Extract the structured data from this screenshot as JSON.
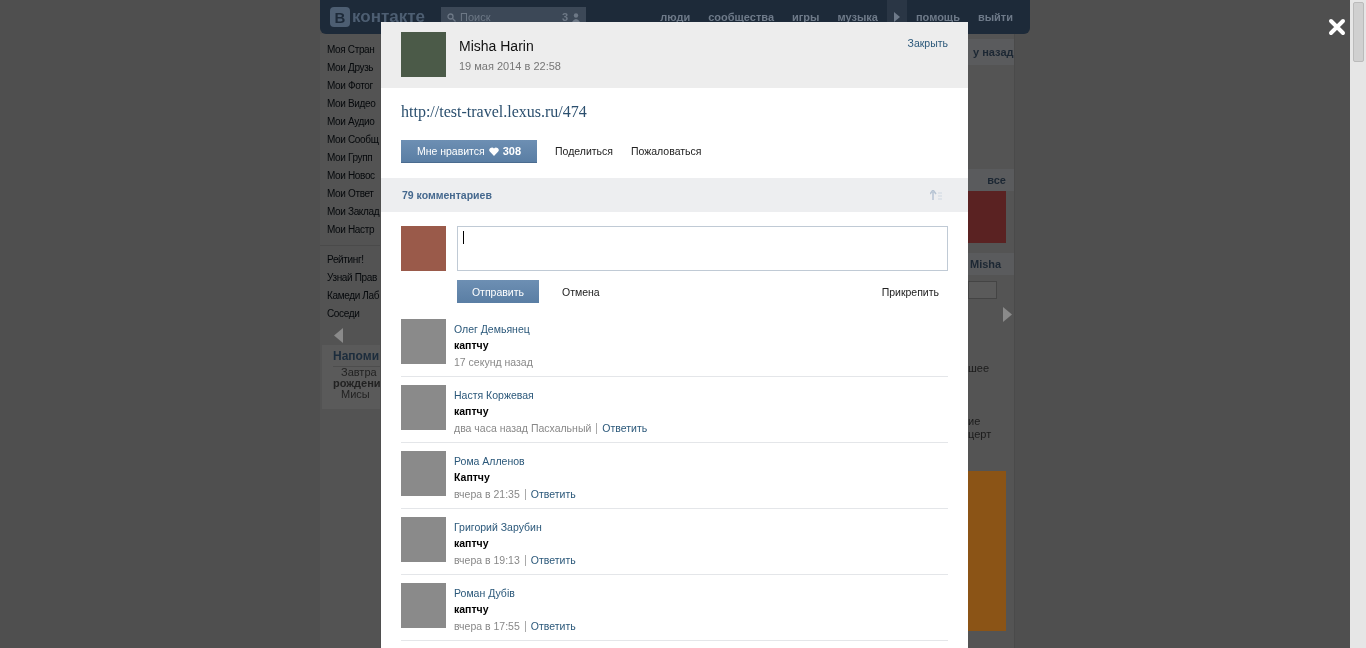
{
  "background_page": {
    "header": {
      "logo_letter": "В",
      "logo_text": "контакте",
      "search": {
        "placeholder": "Поиск",
        "count": "3"
      },
      "nav": [
        {
          "label": "люди",
          "kind": "link"
        },
        {
          "label": "сообщества",
          "kind": "link"
        },
        {
          "label": "игры",
          "kind": "link"
        },
        {
          "label": "музыка",
          "kind": "link"
        },
        {
          "kind": "player"
        },
        {
          "label": "помощь",
          "kind": "link"
        },
        {
          "label": "выйти",
          "kind": "link"
        }
      ]
    },
    "sidebar": {
      "menu": [
        "Моя Стран",
        "Мои Друзь",
        "Мои Фотог",
        "Мои Видео",
        "Мои Аудио",
        "Мои Сообщ",
        "Мои Групп",
        "Мои Новос",
        "Мои Ответ",
        "Мои Заклад",
        "Мои Настр"
      ],
      "apps": [
        "Рейтинг!",
        "Узнай Прав",
        "Камеди Лаб",
        "Соседи"
      ],
      "reminder": {
        "title": "Напоми",
        "lines": [
          {
            "text": "Завтра",
            "emphasis": false
          },
          {
            "text": "рождени",
            "emphasis": true
          },
          {
            "text": "Мисы",
            "emphasis": false
          }
        ]
      }
    },
    "right_column": {
      "header": "у назад",
      "photos_header": "все",
      "friend_header": "Misha",
      "notes": [
        "шее",
        "ие",
        "церт"
      ]
    }
  },
  "post": {
    "author": "Misha Harin",
    "date": "19 мая 2014 в 22:58",
    "close_link": "Закрыть",
    "text": "http://test-travel.lexus.ru/474",
    "like": {
      "label": "Мне нравится",
      "count": "308"
    },
    "links": [
      "Поделиться",
      "Пожаловаться"
    ]
  },
  "comments": {
    "count_label": "79 комментариев",
    "composer": {
      "send": "Отправить",
      "cancel": "Отмена",
      "attach": "Прикрепить"
    },
    "items": [
      {
        "author": "Олег Демьянец",
        "text": "каптчу",
        "time": "17 секунд назад"
      },
      {
        "author": "Настя Коржевая",
        "text": "каптчу",
        "time": "два часа назад Пасхальный",
        "reply": "Ответить"
      },
      {
        "author": "Рома Алленов",
        "text": "Каптчу",
        "time": "вчера в 21:35",
        "reply": "Ответить"
      },
      {
        "author": "Григорий Зарубин",
        "text": "каптчу",
        "time": "вчера в 19:13",
        "reply": "Ответить"
      },
      {
        "author": "Роман Дубiв",
        "text": "каптчу",
        "time": "вчера в 17:55",
        "reply": "Ответить"
      }
    ]
  }
}
